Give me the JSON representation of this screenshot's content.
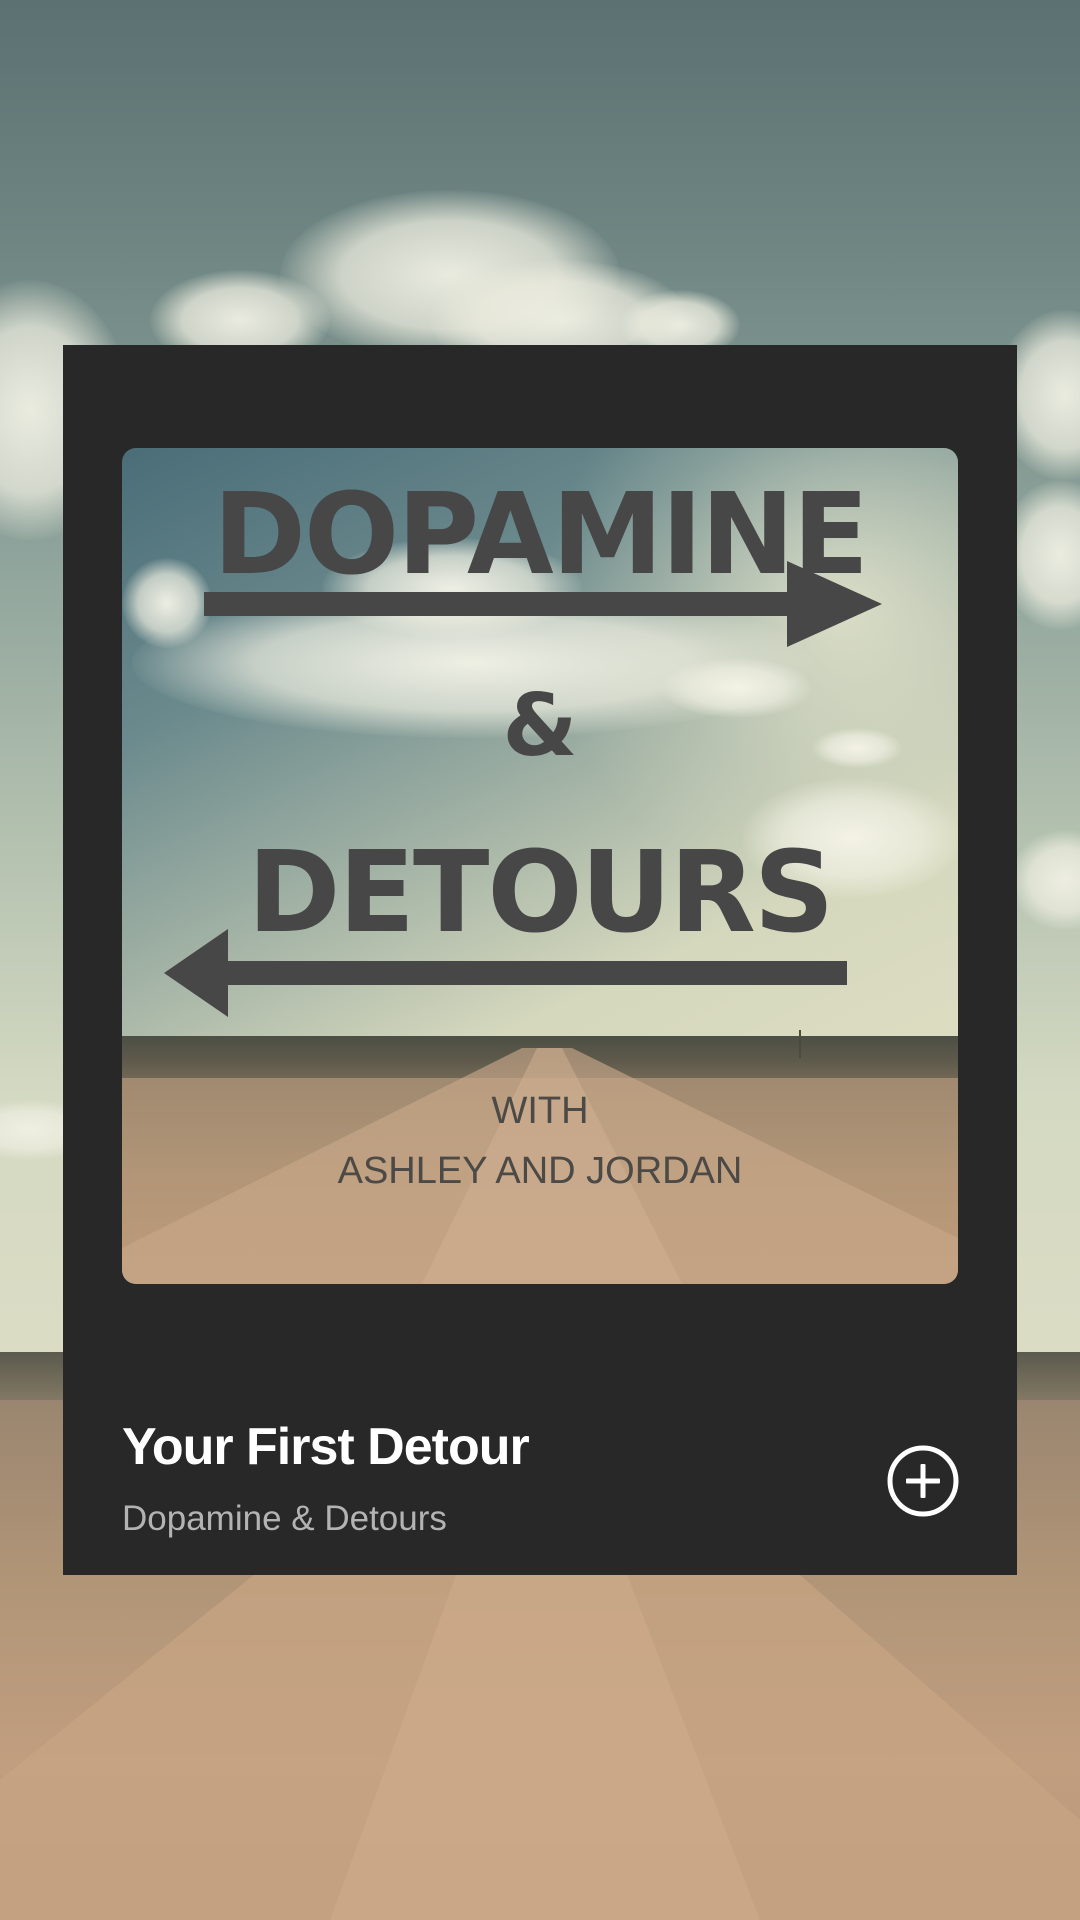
{
  "cover": {
    "title_line1": "DOPAMINE",
    "ampersand": "&",
    "title_line2": "DETOURS",
    "with_label": "WITH",
    "hosts": "ASHLEY AND JORDAN"
  },
  "episode": {
    "title": "Your First Detour",
    "show": "Dopamine & Detours"
  },
  "actions": {
    "add_icon": "plus-circle-icon"
  },
  "colors": {
    "card_background": "#282828",
    "title_text": "#ffffff",
    "subtitle_text": "#b3b3b3",
    "cover_lettering": "#474747"
  }
}
